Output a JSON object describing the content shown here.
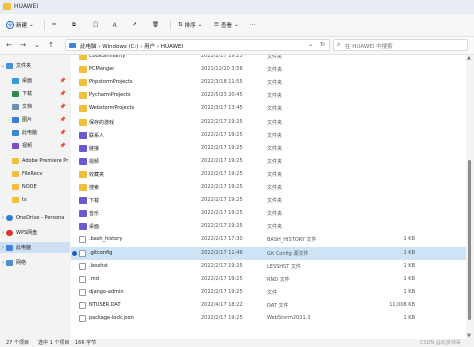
{
  "window": {
    "title": "HUAWEI"
  },
  "toolbar": {
    "new_label": "新建",
    "sort_label": "排序",
    "view_label": "查看",
    "more_label": "···"
  },
  "address": {
    "path": "此电脑 › Windows (C:) › 用户 › HUAWEI"
  },
  "search": {
    "placeholder": "在 HUAWEI 中搜索"
  },
  "sidebar": {
    "items": [
      {
        "label": "文件夹"
      },
      {
        "label": "桌面",
        "pin": "📌"
      },
      {
        "label": "下载",
        "pin": "📌"
      },
      {
        "label": "文档",
        "pin": "📌"
      },
      {
        "label": "图片",
        "pin": "📌"
      },
      {
        "label": "此电脑",
        "pin": "📌"
      },
      {
        "label": "视频",
        "pin": "📌"
      },
      {
        "label": "Adobe Premiere Pr"
      },
      {
        "label": "FileRecv"
      },
      {
        "label": "NODE"
      },
      {
        "label": "ts"
      },
      {
        "label": "OneDrive - Persona"
      },
      {
        "label": "WPS网盘"
      },
      {
        "label": "此电脑"
      },
      {
        "label": "网络"
      }
    ]
  },
  "files": [
    {
      "name": "CodeSimilarity",
      "date": "2022/2/17 19:25",
      "type": "文件夹",
      "size": "",
      "kind": "folder"
    },
    {
      "name": "PCManger",
      "date": "2021/12/20 3:58",
      "type": "文件夹",
      "size": "",
      "kind": "folder"
    },
    {
      "name": "PhpstormProjects",
      "date": "2022/3/18 11:55",
      "type": "文件夹",
      "size": "",
      "kind": "folder"
    },
    {
      "name": "PycharmProjects",
      "date": "2022/5/23 20:45",
      "type": "文件夹",
      "size": "",
      "kind": "folder"
    },
    {
      "name": "WebstormProjects",
      "date": "2022/3/17 13:45",
      "type": "文件夹",
      "size": "",
      "kind": "folder"
    },
    {
      "name": "保存的游戏",
      "date": "2022/2/17 19:25",
      "type": "文件夹",
      "size": "",
      "kind": "folder"
    },
    {
      "name": "联系人",
      "date": "2022/2/17 19:25",
      "type": "文件夹",
      "size": "",
      "kind": "special"
    },
    {
      "name": "链接",
      "date": "2022/2/17 19:25",
      "type": "文件夹",
      "size": "",
      "kind": "special"
    },
    {
      "name": "视频",
      "date": "2022/2/17 19:25",
      "type": "文件夹",
      "size": "",
      "kind": "special"
    },
    {
      "name": "收藏夹",
      "date": "2022/2/17 19:25",
      "type": "文件夹",
      "size": "",
      "kind": "folder"
    },
    {
      "name": "搜索",
      "date": "2022/2/17 19:25",
      "type": "文件夹",
      "size": "",
      "kind": "folder"
    },
    {
      "name": "下载",
      "date": "2022/2/17 19:25",
      "type": "文件夹",
      "size": "",
      "kind": "special"
    },
    {
      "name": "音乐",
      "date": "2022/2/17 19:25",
      "type": "文件夹",
      "size": "",
      "kind": "special"
    },
    {
      "name": "桌面",
      "date": "2022/2/17 19:25",
      "type": "文件夹",
      "size": "",
      "kind": "special"
    },
    {
      "name": ".bash_history",
      "date": "2022/2/17 17:30",
      "type": "BASH_HISTORY 文件",
      "size": "1 KB",
      "kind": "file"
    },
    {
      "name": ".gitconfig",
      "date": "2022/2/17 11:46",
      "type": "Git Config 源文件",
      "size": "1 KB",
      "kind": "file"
    },
    {
      "name": ".lesshst",
      "date": "2022/2/17 19:25",
      "type": "LESSHST 文件",
      "size": "1 KB",
      "kind": "file"
    },
    {
      "name": ".rnd",
      "date": "2022/2/17 19:25",
      "type": "RND 文件",
      "size": "1 KB",
      "kind": "file"
    },
    {
      "name": "django-admin",
      "date": "2022/2/17 19:25",
      "type": "文件",
      "size": "1 KB",
      "kind": "file"
    },
    {
      "name": "NTUSER.DAT",
      "date": "2022/4/17 18:22",
      "type": "DAT 文件",
      "size": "11,008 KB",
      "kind": "file"
    },
    {
      "name": "package-lock.json",
      "date": "2022/2/17 19:25",
      "type": "WebStorm2021.3",
      "size": "1 KB",
      "kind": "file"
    }
  ],
  "status": {
    "count": "27 个项目",
    "selected": "选中 1 个项目",
    "size": "166 字节",
    "watermark": "CSDN @北京帅哥"
  }
}
